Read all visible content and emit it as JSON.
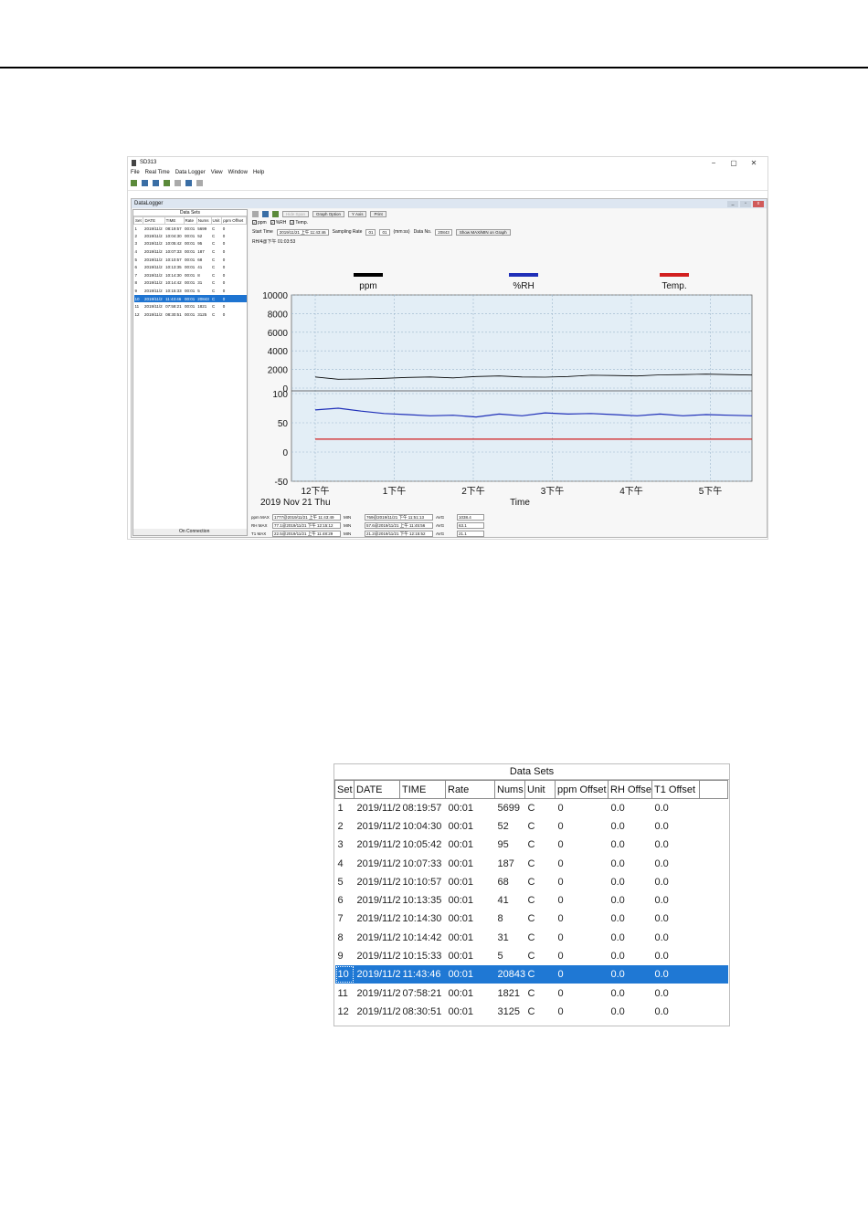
{
  "app": {
    "title": "SD313",
    "window_controls": [
      "−",
      "▢",
      "✕"
    ],
    "menu": [
      "File",
      "Real Time",
      "Data Logger",
      "View",
      "Window",
      "Help"
    ],
    "child_title": "DataLogger",
    "status": "On Connection"
  },
  "graph_controls": {
    "buttons": [
      "Hide Span",
      "Graph Option",
      "Y Axis",
      "Print"
    ],
    "checks": [
      "ppm",
      "%RH",
      "Temp."
    ],
    "start_time_label": "Start Time",
    "start_time_value": "2019/11/21 上午 11:43:46",
    "sampling_label": "Sampling Rate",
    "sampling_values": [
      "01",
      "01"
    ],
    "sampling_unit": "(mm:ss)",
    "data_no_label": "Data No.",
    "data_no_value": "20843",
    "show_button": "Show MAX/MIN on Graph",
    "cursor_readout": "RH/4@下午 01:03:53"
  },
  "chart_data": {
    "type": "line",
    "legend": [
      {
        "name": "ppm",
        "color": "#000000"
      },
      {
        "name": "%RH",
        "color": "#1f2fb8"
      },
      {
        "name": "Temp.",
        "color": "#d21f1f"
      }
    ],
    "top_axis": {
      "ticks": [
        "10000",
        "8000",
        "6000",
        "4000",
        "2000",
        "0"
      ],
      "ylim": [
        0,
        10000
      ]
    },
    "bottom_axis": {
      "ticks": [
        "100",
        "50",
        "0",
        "-50"
      ],
      "ylim": [
        -50,
        100
      ]
    },
    "x_ticks": [
      "12下午",
      "1下午",
      "2下午",
      "3下午",
      "4下午",
      "5下午"
    ],
    "date_label": "2019 Nov 21 Thu",
    "xlabel": "Time",
    "series": [
      {
        "name": "ppm",
        "values": [
          1200,
          950,
          980,
          1050,
          1150,
          1200,
          1100,
          1250,
          1300,
          1200,
          1180,
          1250,
          1380,
          1350,
          1300,
          1420,
          1450,
          1500,
          1450,
          1400
        ]
      },
      {
        "name": "%RH",
        "values": [
          72,
          75,
          70,
          66,
          64,
          62,
          63,
          60,
          65,
          62,
          67,
          65,
          66,
          64,
          62,
          65,
          62,
          64,
          63,
          62
        ]
      },
      {
        "name": "Temp.",
        "values": [
          22,
          22,
          22,
          22,
          22,
          22,
          22,
          22,
          22,
          22,
          22,
          22,
          22,
          22,
          22,
          22,
          22,
          22,
          22,
          22
        ]
      }
    ]
  },
  "stats": [
    {
      "label": "ppm MAX",
      "max": "1777@2019/11/21 上午 11:43:49",
      "min_label": "MIN",
      "min": "769@2019/11/21 下午 11:51:13",
      "avg_label": "AVG",
      "avg": "1038.4"
    },
    {
      "label": "RH MAX",
      "max": "77.1@2019/11/21 下午 12:15:12",
      "min_label": "MIN",
      "min": "57.6@2019/11/21 上午 11:45:56",
      "avg_label": "AVG",
      "avg": "63.1"
    },
    {
      "label": "T1 MAX",
      "max": "22.5@2019/11/21 上午 11:48:29",
      "min_label": "MIN",
      "min": "21.2@2019/11/21 下午 12:15:52",
      "avg_label": "AVG",
      "avg": "21.1"
    }
  ],
  "datasets": {
    "title": "Data Sets",
    "columns": [
      "Set",
      "DATE",
      "TIME",
      "Rate",
      "Nums",
      "Unit",
      "ppm Offset",
      "RH Offse",
      "T1 Offset",
      ""
    ],
    "rows": [
      [
        "1",
        "2019/11/2",
        "08:19:57",
        "00:01",
        "5699",
        "C",
        "0",
        "0.0",
        "0.0"
      ],
      [
        "2",
        "2019/11/2",
        "10:04:30",
        "00:01",
        "52",
        "C",
        "0",
        "0.0",
        "0.0"
      ],
      [
        "3",
        "2019/11/2",
        "10:05:42",
        "00:01",
        "95",
        "C",
        "0",
        "0.0",
        "0.0"
      ],
      [
        "4",
        "2019/11/2",
        "10:07:33",
        "00:01",
        "187",
        "C",
        "0",
        "0.0",
        "0.0"
      ],
      [
        "5",
        "2019/11/2",
        "10:10:57",
        "00:01",
        "68",
        "C",
        "0",
        "0.0",
        "0.0"
      ],
      [
        "6",
        "2019/11/2",
        "10:13:35",
        "00:01",
        "41",
        "C",
        "0",
        "0.0",
        "0.0"
      ],
      [
        "7",
        "2019/11/2",
        "10:14:30",
        "00:01",
        "8",
        "C",
        "0",
        "0.0",
        "0.0"
      ],
      [
        "8",
        "2019/11/2",
        "10:14:42",
        "00:01",
        "31",
        "C",
        "0",
        "0.0",
        "0.0"
      ],
      [
        "9",
        "2019/11/2",
        "10:15:33",
        "00:01",
        "5",
        "C",
        "0",
        "0.0",
        "0.0"
      ],
      [
        "10",
        "2019/11/2",
        "11:43:46",
        "00:01",
        "20843",
        "C",
        "0",
        "0.0",
        "0.0"
      ],
      [
        "11",
        "2019/11/2",
        "07:58:21",
        "00:01",
        "1821",
        "C",
        "0",
        "0.0",
        "0.0"
      ],
      [
        "12",
        "2019/11/2",
        "08:30:51",
        "00:01",
        "3125",
        "C",
        "0",
        "0.0",
        "0.0"
      ]
    ],
    "selected_index": 9
  },
  "colors": {
    "selection": "#1f78d4",
    "plot_bg": "#e3eef6"
  }
}
